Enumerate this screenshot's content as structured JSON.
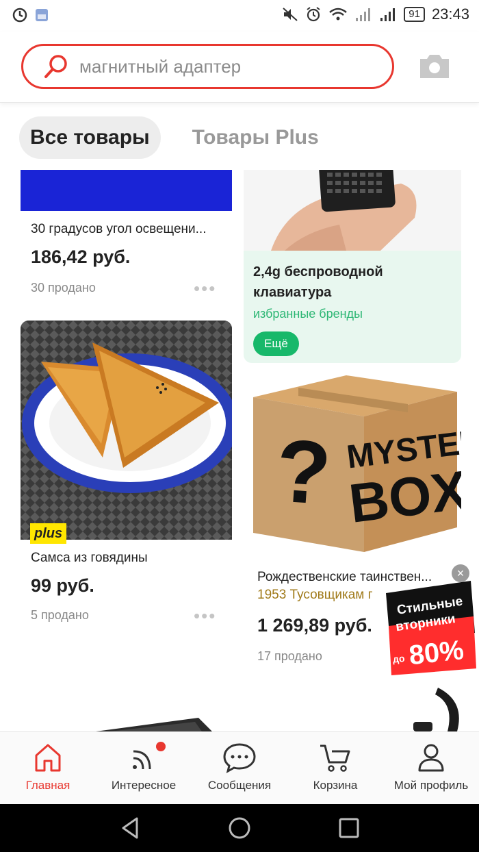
{
  "status_bar": {
    "time": "23:43",
    "battery": "91"
  },
  "search": {
    "query": "магнитный адаптер"
  },
  "tabs": [
    {
      "label": "Все товары",
      "active": true
    },
    {
      "label": "Товары Plus",
      "active": false
    }
  ],
  "products": {
    "angle_light": {
      "title": "30 градусов угол освещени...",
      "price": "186,42 руб.",
      "sold": "30 продано"
    },
    "keyboard": {
      "title": "2,4g беспроводной клавиатура",
      "subtitle": "избранные бренды",
      "button": "Ещё"
    },
    "samsa": {
      "badge": "plus",
      "title": "Самса из говядины",
      "price": "99 руб.",
      "sold": "5 продано"
    },
    "mystery_box": {
      "image_text_1": "MYSTERY",
      "image_text_2": "BOX",
      "title": "Рождественские таинствен...",
      "store": "1953 Тусовщикам г",
      "price": "1 269,89 руб.",
      "sold": "17 продано"
    }
  },
  "promo": {
    "line1": "Стильные",
    "line2": "вторники",
    "prefix": "до",
    "discount": "80%"
  },
  "bottom_nav": [
    {
      "label": "Главная",
      "icon": "home-icon",
      "active": true
    },
    {
      "label": "Интересное",
      "icon": "feed-icon",
      "active": false
    },
    {
      "label": "Сообщения",
      "icon": "chat-icon",
      "active": false
    },
    {
      "label": "Корзина",
      "icon": "cart-icon",
      "active": false
    },
    {
      "label": "Мой профиль",
      "icon": "profile-icon",
      "active": false
    }
  ],
  "colors": {
    "accent": "#e8372f",
    "green": "#17b86a",
    "plus_yellow": "#ffe600",
    "store_gold": "#a07a1a"
  }
}
